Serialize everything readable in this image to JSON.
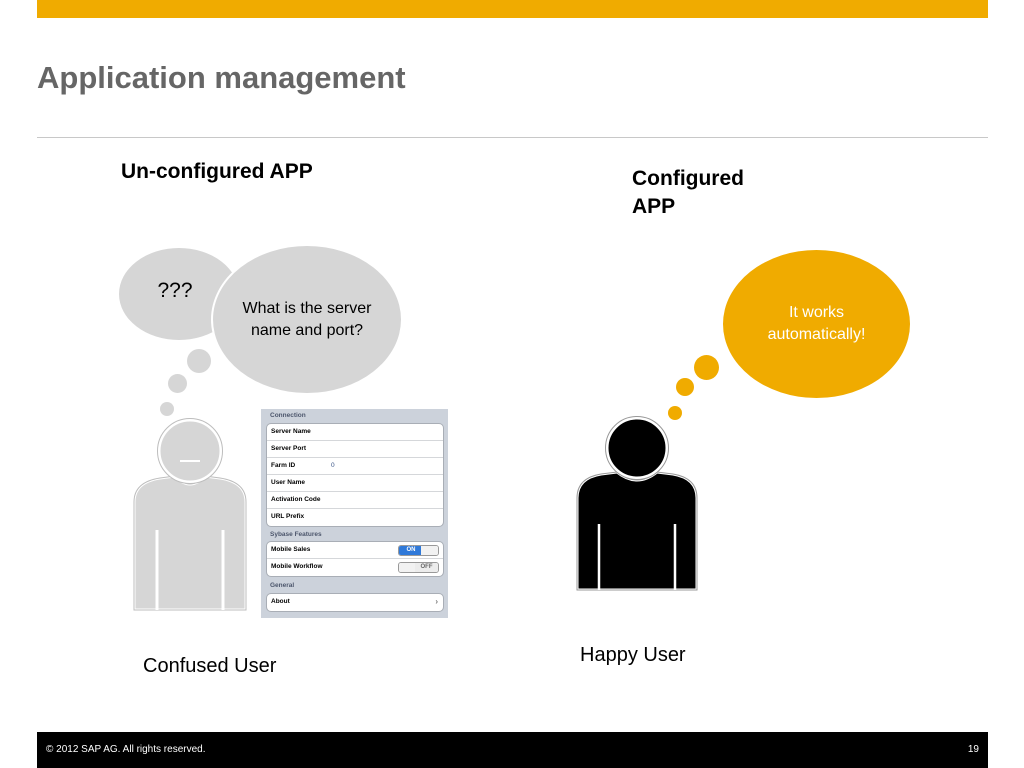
{
  "slide": {
    "title": "Application management",
    "left_heading": "Un-configured APP",
    "right_heading": "Configured APP",
    "bubble_question": "???",
    "bubble_server": "What is the server name and port?",
    "bubble_works": "It works automatically!",
    "caption_left": "Confused User",
    "caption_right": "Happy User"
  },
  "settings": {
    "section_connection": "Connection",
    "connection_rows": [
      {
        "label": "Server Name",
        "value": ""
      },
      {
        "label": "Server Port",
        "value": ""
      },
      {
        "label": "Farm ID",
        "value": "0"
      },
      {
        "label": "User Name",
        "value": ""
      },
      {
        "label": "Activation Code",
        "value": ""
      },
      {
        "label": "URL Prefix",
        "value": ""
      }
    ],
    "section_features": "Sybase Features",
    "mobile_sales_label": "Mobile Sales",
    "mobile_sales_state": "ON",
    "mobile_workflow_label": "Mobile Workflow",
    "mobile_workflow_state": "OFF",
    "section_general": "General",
    "about_label": "About"
  },
  "footer": {
    "copyright": "©  2012 SAP AG. All rights reserved.",
    "page_number": "19"
  },
  "colors": {
    "accent": "#f0ab00",
    "title_grey": "#666666",
    "bubble_grey": "#d6d6d6",
    "footer_bg": "#000000"
  }
}
